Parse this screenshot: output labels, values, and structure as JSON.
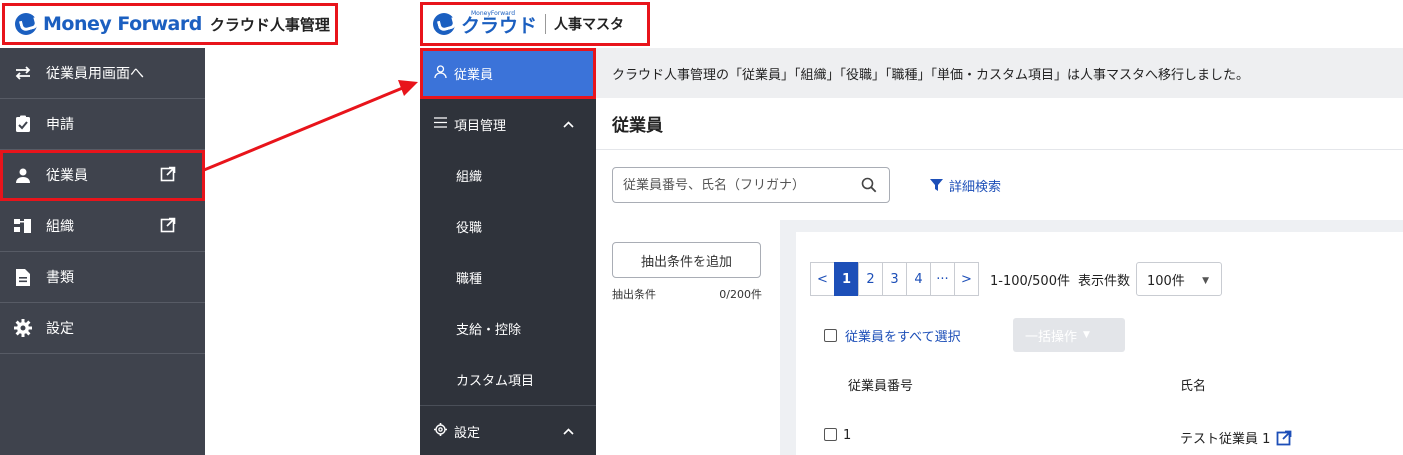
{
  "left_panel": {
    "brand": "Money Forward",
    "product": "クラウド人事管理",
    "menu": [
      {
        "icon": "switch-arrows-icon",
        "label": "従業員用画面へ"
      },
      {
        "icon": "clipboard-check-icon",
        "label": "申請"
      },
      {
        "icon": "person-icon",
        "label": "従業員",
        "external": true,
        "highlighted": true
      },
      {
        "icon": "org-chart-icon",
        "label": "組織",
        "external": true
      },
      {
        "icon": "document-icon",
        "label": "書類"
      },
      {
        "icon": "gear-icon",
        "label": "設定"
      }
    ]
  },
  "right_panel": {
    "logo_small": "MoneyForward",
    "logo_cloud": "クラウド",
    "product": "人事マスタ",
    "sidebar": {
      "employees": "従業員",
      "item_management": "項目管理",
      "sub_items": [
        "組織",
        "役職",
        "職種",
        "支給・控除",
        "カスタム項目"
      ],
      "settings": "設定"
    },
    "notice": "クラウド人事管理の「従業員」「組織」「役職」「職種」「単価・カスタム項目」は人事マスタへ移行しました。",
    "page_title": "従業員",
    "search": {
      "placeholder": "従業員番号、氏名（フリガナ）"
    },
    "advanced_search": "詳細検索",
    "add_condition": "抽出条件を追加",
    "condition_label": "抽出条件",
    "condition_count": "0/200件",
    "pagination": {
      "prev": "<",
      "pages": [
        "1",
        "2",
        "3",
        "4",
        "···"
      ],
      "current": "1",
      "next": ">",
      "range": "1-100/500件",
      "per_page_label": "表示件数",
      "per_page_value": "100件"
    },
    "select_all": "従業員をすべて選択",
    "bulk_action": "一括操作",
    "columns": {
      "number": "従業員番号",
      "name": "氏名"
    },
    "rows": [
      {
        "number": "1",
        "name": "テスト従業員 1"
      }
    ]
  },
  "colors": {
    "highlight": "#e8141b",
    "brand_blue": "#1b5fc0",
    "active_blue": "#3b73d9",
    "sidebar_dark": "#2f333b",
    "sidebar_gray": "#3f434d"
  }
}
